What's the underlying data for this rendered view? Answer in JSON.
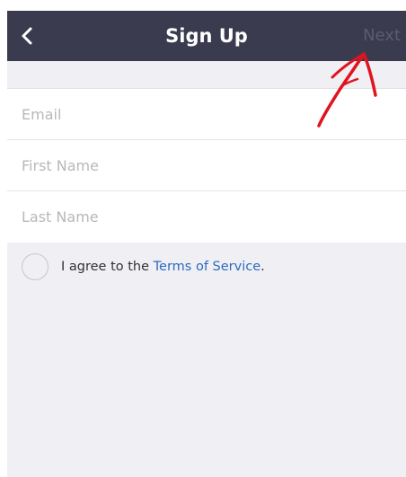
{
  "navbar": {
    "title": "Sign Up",
    "next_label": "Next",
    "background": "#3a3b4f"
  },
  "form": {
    "email_placeholder": "Email",
    "first_name_placeholder": "First Name",
    "last_name_placeholder": "Last Name"
  },
  "agree": {
    "prefix": "I agree to the ",
    "terms_label": "Terms of Service",
    "suffix": "."
  },
  "colors": {
    "link": "#2d6cc0",
    "annotation": "#e0141e",
    "page_background": "#efeff4"
  },
  "icons": {
    "back": "chevron-left-icon",
    "annotation": "arrow-annotation"
  }
}
